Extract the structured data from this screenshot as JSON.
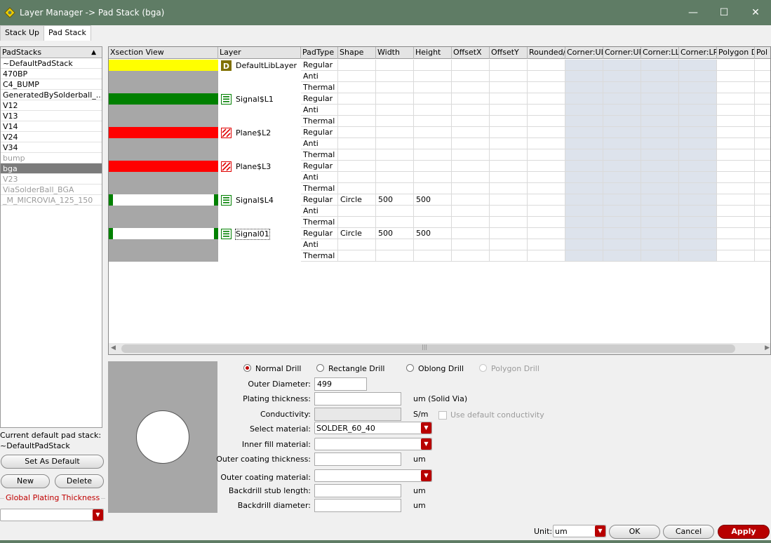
{
  "window": {
    "title": "Layer Manager -> Pad Stack (bga)",
    "minimize": "—",
    "maximize": "☐",
    "close": "✕"
  },
  "tabs": [
    {
      "label": "Stack Up"
    },
    {
      "label": "Pad Stack"
    }
  ],
  "padstacks": {
    "header": "PadStacks",
    "items": [
      {
        "label": "~DefaultPadStack"
      },
      {
        "label": "470BP"
      },
      {
        "label": "C4_BUMP"
      },
      {
        "label": "GeneratedBySolderball_..."
      },
      {
        "label": "V12"
      },
      {
        "label": "V13"
      },
      {
        "label": "V14"
      },
      {
        "label": "V24"
      },
      {
        "label": "V34"
      },
      {
        "label": "bump"
      },
      {
        "label": "bga"
      },
      {
        "label": "V23"
      },
      {
        "label": "ViaSolderBall_BGA"
      },
      {
        "label": "_M_MICROVIA_125_150"
      }
    ],
    "selected": "bga",
    "current_default_label": "Current default pad stack:",
    "current_default_value": "~DefaultPadStack",
    "set_default_label": "Set As Default",
    "new_label": "New",
    "delete_label": "Delete",
    "global_plating_label": "Global Plating Thickness",
    "global_plating_value": ""
  },
  "grid": {
    "columns": [
      "Xsection View",
      "Layer",
      "PadType",
      "Shape",
      "Width",
      "Height",
      "OffsetX",
      "OffsetY",
      "Rounded/",
      "Corner:UL",
      "Corner:UR",
      "Corner:LL",
      "Corner:LR",
      "Polygon D",
      "Pol"
    ],
    "layers": [
      {
        "name": "DefaultLibLayer",
        "icon": "D",
        "color": "#ffff00",
        "kind": "default",
        "rows": [
          {
            "padtype": "Regular",
            "shape": "",
            "width": "",
            "height": ""
          },
          {
            "padtype": "Anti",
            "shape": "",
            "width": "",
            "height": ""
          },
          {
            "padtype": "Thermal",
            "shape": "",
            "width": "",
            "height": ""
          }
        ]
      },
      {
        "name": "Signal$L1",
        "icon": "signal",
        "color": "#008000",
        "kind": "full",
        "rows": [
          {
            "padtype": "Regular",
            "shape": "",
            "width": "",
            "height": ""
          },
          {
            "padtype": "Anti",
            "shape": "",
            "width": "",
            "height": ""
          },
          {
            "padtype": "Thermal",
            "shape": "",
            "width": "",
            "height": ""
          }
        ]
      },
      {
        "name": "Plane$L2",
        "icon": "plane",
        "color": "#ff0000",
        "kind": "full",
        "rows": [
          {
            "padtype": "Regular",
            "shape": "",
            "width": "",
            "height": ""
          },
          {
            "padtype": "Anti",
            "shape": "",
            "width": "",
            "height": ""
          },
          {
            "padtype": "Thermal",
            "shape": "",
            "width": "",
            "height": ""
          }
        ]
      },
      {
        "name": "Plane$L3",
        "icon": "plane",
        "color": "#ff0000",
        "kind": "full",
        "rows": [
          {
            "padtype": "Regular",
            "shape": "",
            "width": "",
            "height": ""
          },
          {
            "padtype": "Anti",
            "shape": "",
            "width": "",
            "height": ""
          },
          {
            "padtype": "Thermal",
            "shape": "",
            "width": "",
            "height": ""
          }
        ]
      },
      {
        "name": "Signal$L4",
        "icon": "signal",
        "color": "#008000",
        "kind": "pad",
        "rows": [
          {
            "padtype": "Regular",
            "shape": "Circle",
            "width": "500",
            "height": "500"
          },
          {
            "padtype": "Anti",
            "shape": "",
            "width": "",
            "height": ""
          },
          {
            "padtype": "Thermal",
            "shape": "",
            "width": "",
            "height": ""
          }
        ]
      },
      {
        "name": "Signal01",
        "icon": "signal",
        "color": "#008000",
        "kind": "pad",
        "rows": [
          {
            "padtype": "Regular",
            "shape": "Circle",
            "width": "500",
            "height": "500"
          },
          {
            "padtype": "Anti",
            "shape": "",
            "width": "",
            "height": ""
          },
          {
            "padtype": "Thermal",
            "shape": "",
            "width": "",
            "height": ""
          }
        ]
      }
    ],
    "scroll_grip": "|||"
  },
  "drill": {
    "options": [
      {
        "label": "Normal Drill",
        "selected": true,
        "enabled": true
      },
      {
        "label": "Rectangle Drill",
        "selected": false,
        "enabled": true
      },
      {
        "label": "Oblong Drill",
        "selected": false,
        "enabled": true
      },
      {
        "label": "Polygon Drill",
        "selected": false,
        "enabled": false
      }
    ],
    "outer_diameter_label": "Outer Diameter:",
    "outer_diameter_value": "499",
    "plating_label": "Plating thickness:",
    "plating_value": "",
    "plating_unit": "um (Solid Via)",
    "conductivity_label": "Conductivity:",
    "conductivity_unit": "S/m",
    "use_default_label": "Use default conductivity",
    "material_label": "Select material:",
    "material_value": "SOLDER_60_40",
    "inner_fill_label": "Inner fill material:",
    "inner_fill_value": "",
    "outer_coating_thickness_label": "Outer coating thickness:",
    "outer_coating_thickness_unit": "um",
    "outer_coating_material_label": "Outer coating material:",
    "outer_coating_material_value": "",
    "backdrill_stub_label": "Backdrill stub length:",
    "backdrill_stub_unit": "um",
    "backdrill_diameter_label": "Backdrill diameter:",
    "backdrill_diameter_unit": "um"
  },
  "footer": {
    "unit_label": "Unit:",
    "unit_value": "um",
    "ok": "OK",
    "cancel": "Cancel",
    "apply": "Apply"
  },
  "colors": {
    "titlebar": "#5f7c65",
    "accent": "#b80000",
    "selected_row": "#7b7b7b"
  }
}
